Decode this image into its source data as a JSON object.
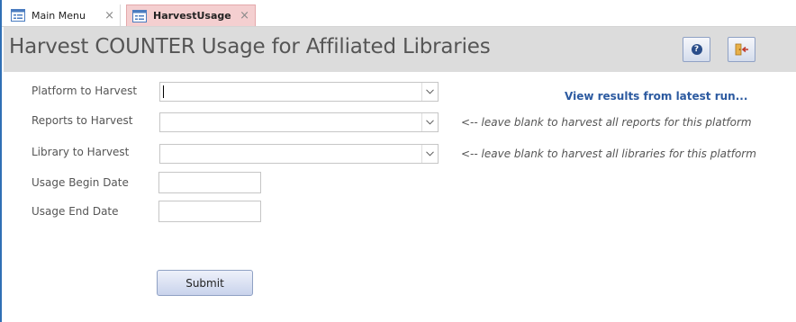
{
  "tabs": [
    {
      "label": "Main Menu",
      "close": "×",
      "active": false
    },
    {
      "label": "HarvestUsage",
      "close": "×",
      "active": true
    }
  ],
  "header": {
    "title": "Harvest COUNTER Usage for Affiliated Libraries",
    "help_icon": "question-icon",
    "help_glyph": "?",
    "exit_icon": "exit-door-icon"
  },
  "form": {
    "platform": {
      "label": "Platform to Harvest",
      "value": ""
    },
    "reports": {
      "label": "Reports to Harvest",
      "value": "",
      "hint": "<-- leave blank to harvest all reports for this platform"
    },
    "library": {
      "label": "Library  to Harvest",
      "value": "",
      "hint": "<-- leave blank to harvest all libraries for this platform"
    },
    "begin_date": {
      "label": "Usage Begin Date",
      "value": ""
    },
    "end_date": {
      "label": "Usage End Date",
      "value": ""
    },
    "view_results_link": "View results from latest run...",
    "submit_label": "Submit"
  },
  "colors": {
    "accent_border": "#2f6fb5",
    "active_tab": "#f4cfd0",
    "header_bg": "#dcdcdc",
    "link": "#2c5aa0"
  }
}
